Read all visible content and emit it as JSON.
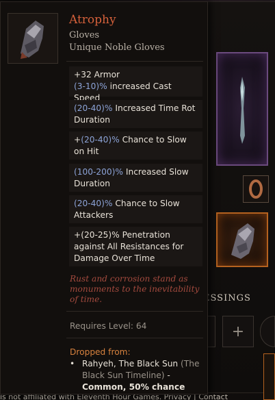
{
  "tooltip": {
    "item_name": "Atrophy",
    "item_type": "Gloves",
    "item_rarity": "Unique Noble Gloves",
    "base_stats": {
      "armor": "+32 Armor",
      "cast_speed_range": "(3-10)%",
      "cast_speed_text": " increased Cast Speed"
    },
    "mods": [
      {
        "range": "(20-40)%",
        "text": " Increased Time Rot Duration"
      },
      {
        "prefix": "+",
        "range": "(20-40)%",
        "text": " Chance to Slow on Hit"
      },
      {
        "range": "(100-200)%",
        "text": " Increased Slow Duration"
      },
      {
        "range": "(20-40)%",
        "text": " Chance to Slow Attackers"
      },
      {
        "text": "+(20-25)% Penetration against All Resistances for Damage Over Time"
      }
    ],
    "flavor_text": "Rust and corrosion stand as monuments to the inevitability of time.",
    "requires_level": "Requires Level: 64",
    "dropped_from": {
      "title": "Dropped from:",
      "source_name": "Rahyeh, The Black Sun",
      "source_timeline": " (The Black Sun Timeline)",
      "dash": " - ",
      "chance": "Common, 50% chance"
    }
  },
  "equipment_panel": {
    "blessings_heading": "ESSINGS",
    "add_blessing_symbol": "+"
  },
  "footer": {
    "text": "is not affiliated with Eleventh Hour Games. Privacy | Contact"
  },
  "colors": {
    "unique_name": "#d6613b",
    "range_blue": "#8da4d8",
    "flavor_red": "#a34a3e",
    "dropped_orange": "#d8823e",
    "exalted_purple": "#6b4a7e",
    "unique_orange": "#b5621f"
  }
}
